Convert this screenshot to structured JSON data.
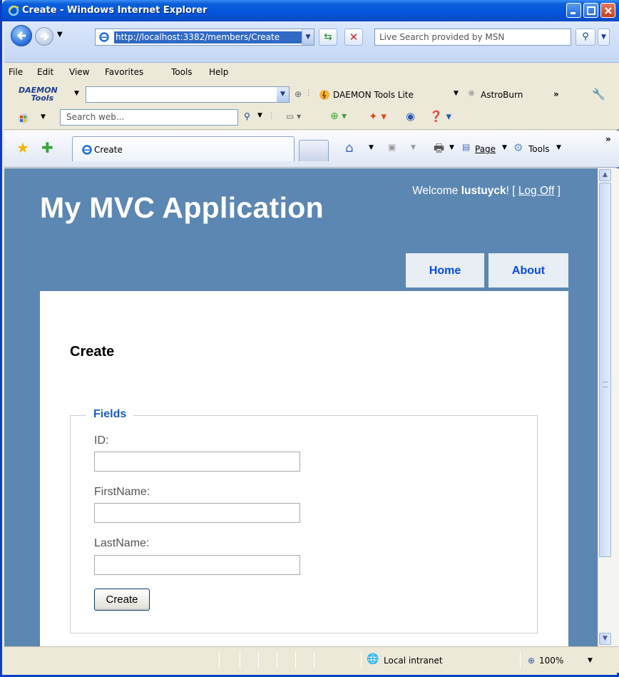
{
  "window": {
    "title": "Create - Windows Internet Explorer"
  },
  "address": {
    "url": "http://localhost:3382/members/Create"
  },
  "search": {
    "placeholder": "Live Search provided by MSN"
  },
  "menu": {
    "items": [
      "File",
      "Edit",
      "View",
      "Favorites",
      "Tools",
      "Help"
    ]
  },
  "toolbar1": {
    "daemon_logo_line1": "DAEMON",
    "daemon_logo_line2": "Tools",
    "daemon_lite": "DAEMON Tools Lite",
    "astroburn": "AstroBurn",
    "more": "»"
  },
  "toolbar2": {
    "search_web": "Search web..."
  },
  "tabs": {
    "active_tab": "Create"
  },
  "commands": {
    "page": "Page",
    "tools": "Tools",
    "more": "»"
  },
  "site": {
    "title": "My MVC Application",
    "welcome_prefix": "Welcome ",
    "username": "lustuyck",
    "welcome_suffix": "! [ ",
    "logoff": "Log Off",
    "close_bracket": " ]",
    "nav": [
      "Home",
      "About"
    ]
  },
  "page": {
    "heading": "Create",
    "legend": "Fields",
    "fields": [
      {
        "label": "ID:",
        "value": ""
      },
      {
        "label": "FirstName:",
        "value": ""
      },
      {
        "label": "LastName:",
        "value": ""
      }
    ],
    "submit": "Create"
  },
  "status": {
    "zone": "Local intranet",
    "zoom": "100%"
  }
}
